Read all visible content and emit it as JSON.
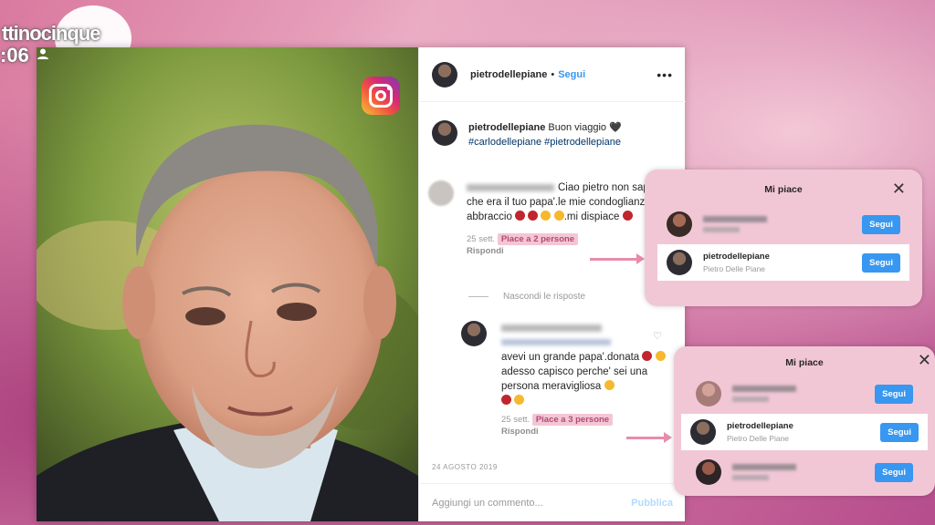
{
  "tv": {
    "brand": "ttinocinque",
    "time": ":06"
  },
  "post": {
    "username": "pietrodellepiane",
    "separator": "•",
    "follow": "Segui",
    "more": "•••",
    "caption_text": "Buon viaggio 🖤",
    "caption_tags": "#carlodellepiane #pietrodellepiane",
    "comment": {
      "text": "Ciao pietro non sapevo che era il tuo papa'.le mie condoglianze.un abbraccio",
      "text_end": ".mi dispiace",
      "time": "25 sett.",
      "likes": "Piace a 2 persone",
      "reply": "Rispondi"
    },
    "hide_replies": "Nascondi le risposte",
    "reply": {
      "text": "avevi un grande papa'.donata",
      "text_mid": "adesso capisco perche' sei una persona meravigliosa",
      "time": "25 sett.",
      "likes": "Piace a 3 persone",
      "reply": "Rispondi"
    },
    "date": "24 AGOSTO 2019",
    "comment_placeholder": "Aggiungi un commento...",
    "publish": "Pubblica"
  },
  "likes_popup_1": {
    "title": "Mi piace",
    "close": "✕",
    "rows": [
      {
        "username": "",
        "fullname": "",
        "button": "Segui",
        "blurred": true
      },
      {
        "username": "pietrodellepiane",
        "fullname": "Pietro Delle Piane",
        "button": "Segui",
        "blurred": false
      }
    ]
  },
  "likes_popup_2": {
    "title": "Mi piace",
    "close": "✕",
    "rows": [
      {
        "username": "",
        "fullname": "",
        "button": "Segui",
        "blurred": true
      },
      {
        "username": "pietrodellepiane",
        "fullname": "Pietro Delle Piane",
        "button": "Segui",
        "blurred": false
      },
      {
        "username": "",
        "fullname": "",
        "button": "Segui",
        "blurred": true
      }
    ]
  },
  "colors": {
    "accent": "#3897f0",
    "highlight": "#f4c6d4",
    "popup": "#f2c7d5"
  }
}
